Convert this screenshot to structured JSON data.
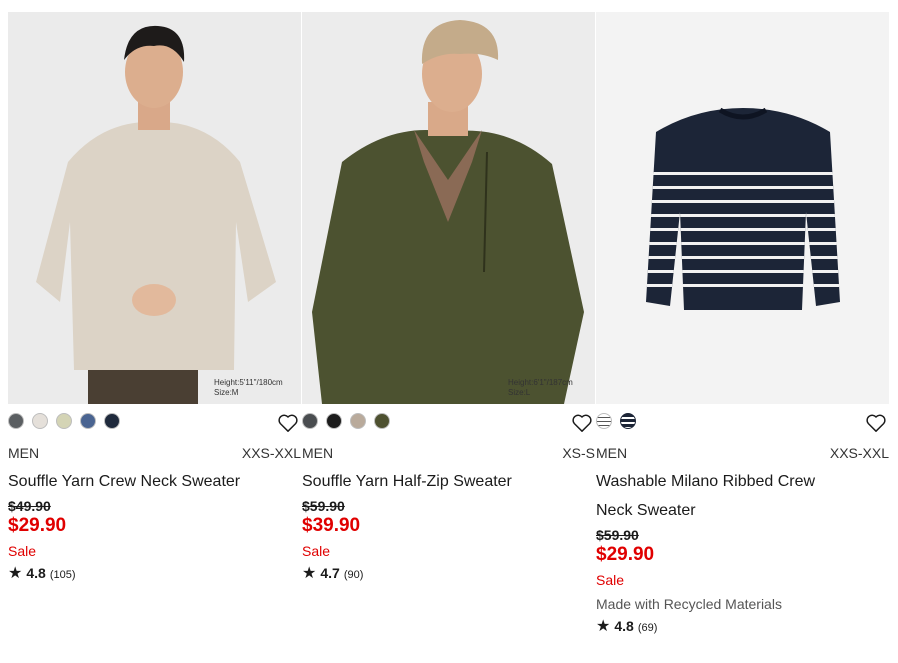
{
  "products": [
    {
      "model_info": [
        "Height:5'11\"/180cm",
        "Size:M"
      ],
      "swatches": [
        "#5b5f62",
        "#e5e0da",
        "#d4d4b5",
        "#4a6491",
        "#1f2a3c"
      ],
      "gender": "MEN",
      "sizes": "XXS-XXL",
      "name_lines": [
        "Souffle Yarn Crew Neck Sweater"
      ],
      "original_price": "$49.90",
      "price": "$29.90",
      "sale_label": "Sale",
      "extra": "",
      "rating": "4.8",
      "review_count": "(105)"
    },
    {
      "model_info": [
        "Height:6'1\"/187cm",
        "Size:L"
      ],
      "swatches": [
        "#4a4d50",
        "#1c1c1c",
        "#b9aa9b",
        "#4e5130"
      ],
      "gender": "MEN",
      "sizes": "XS-S",
      "name_lines": [
        "Souffle Yarn Half-Zip Sweater"
      ],
      "original_price": "$59.90",
      "price": "$39.90",
      "sale_label": "Sale",
      "extra": "",
      "rating": "4.7",
      "review_count": "(90)"
    },
    {
      "model_info": [],
      "swatches": [
        "stripe-white",
        "stripe-navy"
      ],
      "gender": "MEN",
      "sizes": "XXS-XXL",
      "name_lines": [
        "Washable Milano Ribbed Crew",
        "Neck Sweater"
      ],
      "original_price": "$59.90",
      "price": "$29.90",
      "sale_label": "Sale",
      "extra": "Made with Recycled Materials",
      "rating": "4.8",
      "review_count": "(69)"
    }
  ],
  "icons": {
    "favorite": "heart-outline-icon",
    "rating": "star-icon"
  },
  "colors": {
    "sale_red": "#e00000",
    "text": "#1b1b1b"
  }
}
